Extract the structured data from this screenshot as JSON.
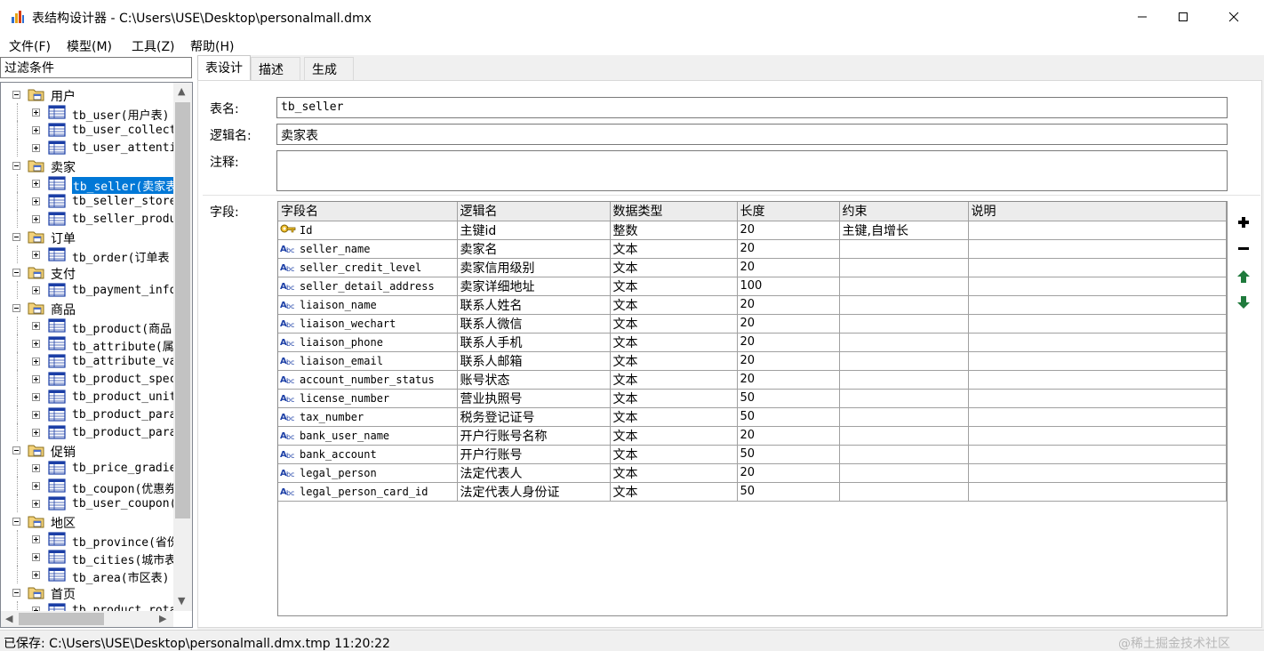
{
  "window": {
    "title": "表结构设计器 - C:\\Users\\USE\\Desktop\\personalmall.dmx"
  },
  "menu": [
    "文件(F)",
    "模型(M)",
    "工具(Z)",
    "帮助(H)"
  ],
  "sidebar": {
    "filter_value": "过滤条件",
    "tree": [
      {
        "label": "用户",
        "type": "folder"
      },
      {
        "label": "tb_user(用户表)",
        "type": "table"
      },
      {
        "label": "tb_user_collect",
        "type": "table"
      },
      {
        "label": "tb_user_attenti",
        "type": "table"
      },
      {
        "label": "卖家",
        "type": "folder"
      },
      {
        "label": "tb_seller(卖家表",
        "type": "table",
        "selected": true
      },
      {
        "label": "tb_seller_store",
        "type": "table"
      },
      {
        "label": "tb_seller_produ",
        "type": "table"
      },
      {
        "label": "订单",
        "type": "folder"
      },
      {
        "label": "tb_order(订单表",
        "type": "table"
      },
      {
        "label": "支付",
        "type": "folder"
      },
      {
        "label": "tb_payment_info",
        "type": "table"
      },
      {
        "label": "商品",
        "type": "folder"
      },
      {
        "label": "tb_product(商品",
        "type": "table"
      },
      {
        "label": "tb_attribute(属",
        "type": "table"
      },
      {
        "label": "tb_attribute_va",
        "type": "table"
      },
      {
        "label": "tb_product_spec",
        "type": "table"
      },
      {
        "label": "tb_product_unit",
        "type": "table"
      },
      {
        "label": "tb_product_para",
        "type": "table"
      },
      {
        "label": "tb_product_para",
        "type": "table"
      },
      {
        "label": "促销",
        "type": "folder"
      },
      {
        "label": "tb_price_gradie",
        "type": "table"
      },
      {
        "label": "tb_coupon(优惠券",
        "type": "table"
      },
      {
        "label": "tb_user_coupon(",
        "type": "table"
      },
      {
        "label": "地区",
        "type": "folder"
      },
      {
        "label": "tb_province(省份",
        "type": "table"
      },
      {
        "label": "tb_cities(城市表",
        "type": "table"
      },
      {
        "label": "tb_area(市区表)",
        "type": "table"
      },
      {
        "label": "首页",
        "type": "folder"
      },
      {
        "label": "tb_product_rota",
        "type": "table"
      }
    ]
  },
  "tabs": [
    "表设计",
    "描述",
    "生成"
  ],
  "form": {
    "table_name_label": "表名:",
    "table_name_value": "tb_seller",
    "logic_name_label": "逻辑名:",
    "logic_name_value": "卖家表",
    "comment_label": "注释:",
    "comment_value": "",
    "fields_label": "字段:"
  },
  "grid": {
    "columns": [
      "字段名",
      "逻辑名",
      "数据类型",
      "长度",
      "约束",
      "说明"
    ],
    "rows": [
      {
        "icon": "key-icon",
        "name": "Id",
        "logic": "主键id",
        "type": "整数",
        "length": "20",
        "constraint": "主键,自增长",
        "desc": ""
      },
      {
        "icon": "text-field-icon",
        "name": "seller_name",
        "logic": "卖家名",
        "type": "文本",
        "length": "20",
        "constraint": "",
        "desc": ""
      },
      {
        "icon": "text-field-icon",
        "name": "seller_credit_level",
        "logic": "卖家信用级别",
        "type": "文本",
        "length": "20",
        "constraint": "",
        "desc": ""
      },
      {
        "icon": "text-field-icon",
        "name": "seller_detail_address",
        "logic": "卖家详细地址",
        "type": "文本",
        "length": "100",
        "constraint": "",
        "desc": ""
      },
      {
        "icon": "text-field-icon",
        "name": "liaison_name",
        "logic": "联系人姓名",
        "type": "文本",
        "length": "20",
        "constraint": "",
        "desc": ""
      },
      {
        "icon": "text-field-icon",
        "name": "liaison_wechart",
        "logic": "联系人微信",
        "type": "文本",
        "length": "20",
        "constraint": "",
        "desc": ""
      },
      {
        "icon": "text-field-icon",
        "name": "liaison_phone",
        "logic": "联系人手机",
        "type": "文本",
        "length": "20",
        "constraint": "",
        "desc": ""
      },
      {
        "icon": "text-field-icon",
        "name": "liaison_email",
        "logic": "联系人邮箱",
        "type": "文本",
        "length": "20",
        "constraint": "",
        "desc": ""
      },
      {
        "icon": "text-field-icon",
        "name": "account_number_status",
        "logic": "账号状态",
        "type": "文本",
        "length": "20",
        "constraint": "",
        "desc": ""
      },
      {
        "icon": "text-field-icon",
        "name": "license_number",
        "logic": "营业执照号",
        "type": "文本",
        "length": "50",
        "constraint": "",
        "desc": ""
      },
      {
        "icon": "text-field-icon",
        "name": "tax_number",
        "logic": "税务登记证号",
        "type": "文本",
        "length": "50",
        "constraint": "",
        "desc": ""
      },
      {
        "icon": "text-field-icon",
        "name": "bank_user_name",
        "logic": "开户行账号名称",
        "type": "文本",
        "length": "20",
        "constraint": "",
        "desc": ""
      },
      {
        "icon": "text-field-icon",
        "name": "bank_account",
        "logic": "开户行账号",
        "type": "文本",
        "length": "50",
        "constraint": "",
        "desc": ""
      },
      {
        "icon": "text-field-icon",
        "name": "legal_person",
        "logic": "法定代表人",
        "type": "文本",
        "length": "20",
        "constraint": "",
        "desc": ""
      },
      {
        "icon": "text-field-icon",
        "name": "legal_person_card_id",
        "logic": "法定代表人身份证",
        "type": "文本",
        "length": "50",
        "constraint": "",
        "desc": ""
      }
    ]
  },
  "status": {
    "text": "已保存: C:\\Users\\USE\\Desktop\\personalmall.dmx.tmp 11:20:22",
    "watermark": "@稀土掘金技术社区"
  },
  "colors": {
    "selection": "#0078d7",
    "add_button": "#000000",
    "arrow_button": "#1f7a3c"
  }
}
